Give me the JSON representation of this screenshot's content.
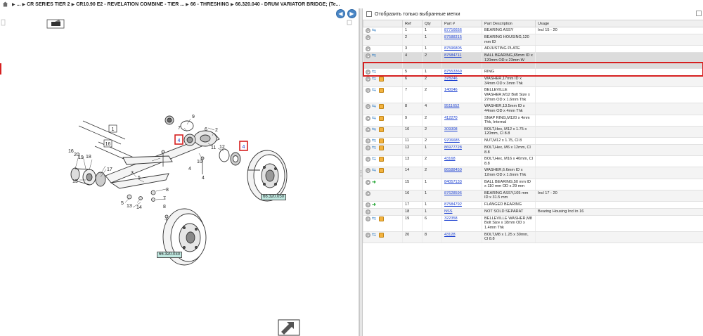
{
  "breadcrumb": {
    "items": [
      "...",
      "CR SERIES TIER 2",
      "CR10.90 E2 - REVELATION COMBINE - TIER ...",
      "66 - THRESHING",
      "66.320.040 - DRUM VARIATOR BRIDGE; (Te..."
    ]
  },
  "filter": {
    "label": "Отобразить только выбранные метки"
  },
  "diagram": {
    "labels": [
      "9",
      "7",
      "6",
      "2",
      "11",
      "12",
      "10",
      "4",
      "1",
      "16",
      "20",
      "19",
      "18",
      "17",
      "15",
      "3",
      "5",
      "5",
      "8",
      "7",
      "13",
      "14",
      "8"
    ],
    "callouts": [
      "66.320.050",
      "66.320.030"
    ],
    "highlight_markers": [
      "4",
      "4"
    ]
  },
  "table": {
    "headers": [
      "",
      "Ref",
      "Qty",
      "Part #",
      "Part Description",
      "Usage"
    ],
    "rows": [
      {
        "icons": [
          "add",
          "swap"
        ],
        "ref": "1",
        "qty": "1",
        "part": "87716656",
        "desc": "BEARING ASSY",
        "usage": "Incl 15 - 20"
      },
      {
        "icons": [
          "add"
        ],
        "ref": "2",
        "qty": "1",
        "part": "87588315",
        "desc": "BEARING HOUSING,120 mm ID",
        "usage": ""
      },
      {
        "icons": [
          "add"
        ],
        "ref": "3",
        "qty": "1",
        "part": "87596805",
        "desc": "ADJUSTING PLATE",
        "usage": ""
      },
      {
        "icons": [
          "add",
          "swap"
        ],
        "ref": "4",
        "qty": "2",
        "part": "87584711",
        "desc": "BALL BEARING,65mm ID x 120mm OD x 23mm W",
        "usage": "",
        "selected": true
      },
      {
        "icons": [
          "add",
          "swap"
        ],
        "ref": "5",
        "qty": "1",
        "part": "87553369",
        "desc": "RING",
        "usage": ""
      },
      {
        "icons": [
          "add",
          "swap",
          "box"
        ],
        "ref": "6",
        "qty": "2",
        "part": "378246",
        "desc": "WASHER,17mm ID x 34mm OD x 3mm Thk",
        "usage": ""
      },
      {
        "icons": [
          "add",
          "swap",
          "box"
        ],
        "ref": "7",
        "qty": "2",
        "part": "140046",
        "desc": "BELLEVILLE WASHER,M12 Bolt Size x 27mm OD x 1.6mm Thk",
        "usage": ""
      },
      {
        "icons": [
          "add",
          "swap",
          "box"
        ],
        "ref": "8",
        "qty": "4",
        "part": "9511652",
        "desc": "WASHER,13.5mm ID x 44mm OD x 4mm Thk",
        "usage": ""
      },
      {
        "icons": [
          "add",
          "swap",
          "box"
        ],
        "ref": "9",
        "qty": "2",
        "part": "412270",
        "desc": "SNAP RING,M120 x 4mm Thk, Internal",
        "usage": ""
      },
      {
        "icons": [
          "add",
          "swap",
          "box"
        ],
        "ref": "10",
        "qty": "2",
        "part": "309308",
        "desc": "BOLT,Hex, M12 x 1.75 x 120mm, Cl 8.8",
        "usage": ""
      },
      {
        "icons": [
          "add",
          "swap",
          "box"
        ],
        "ref": "11",
        "qty": "2",
        "part": "9706685",
        "desc": "NUT,M12 x 1.75, Cl 8",
        "usage": ""
      },
      {
        "icons": [
          "add",
          "swap",
          "box"
        ],
        "ref": "12",
        "qty": "1",
        "part": "86977728",
        "desc": "BOLT,Hex, M6 x 12mm, Cl 8.8",
        "usage": ""
      },
      {
        "icons": [
          "add",
          "swap",
          "box"
        ],
        "ref": "13",
        "qty": "2",
        "part": "43168",
        "desc": "BOLT,Hex, M16 x 40mm, Cl 8.8",
        "usage": ""
      },
      {
        "icons": [
          "add",
          "swap",
          "box"
        ],
        "ref": "14",
        "qty": "2",
        "part": "86588450",
        "desc": "WASHER,6.6mm ID x 12mm OD x 1.6mm Thk",
        "usage": ""
      },
      {
        "icons": [
          "add",
          "green"
        ],
        "ref": "15",
        "qty": "1",
        "part": "84057133",
        "desc": "BALL BEARING,50 mm ID x 110 mm OD x 29 mm",
        "usage": ""
      },
      {
        "icons": [
          "add"
        ],
        "ref": "16",
        "qty": "1",
        "part": "87628596",
        "desc": "BEARING ASSY,105 mm ID x 31.5 mm",
        "usage": "Incl 17 - 20"
      },
      {
        "icons": [
          "add",
          "green"
        ],
        "ref": "17",
        "qty": "1",
        "part": "87584792",
        "desc": "FLANGED BEARING",
        "usage": ""
      },
      {
        "icons": [
          "add"
        ],
        "ref": "18",
        "qty": "1",
        "part": "NSS",
        "desc": "NOT SOLD SEPARAT",
        "usage": "Bearing Housing Incl in 16"
      },
      {
        "icons": [
          "add",
          "swap",
          "box"
        ],
        "ref": "19",
        "qty": "6",
        "part": "322358",
        "desc": "BELLEVILLE WASHER,M8 Bolt Size x 18mm OD x 1.4mm Thk",
        "usage": ""
      },
      {
        "icons": [
          "add",
          "swap",
          "box"
        ],
        "ref": "20",
        "qty": "8",
        "part": "43128",
        "desc": "BOLT,M8 x 1.25 x 30mm, Cl 8.8",
        "usage": ""
      }
    ]
  },
  "colors": {
    "highlight": "#d62020",
    "link": "#1a3fd0",
    "nav_button": "#4a86c5",
    "callout_bg": "#bfe8e0"
  }
}
